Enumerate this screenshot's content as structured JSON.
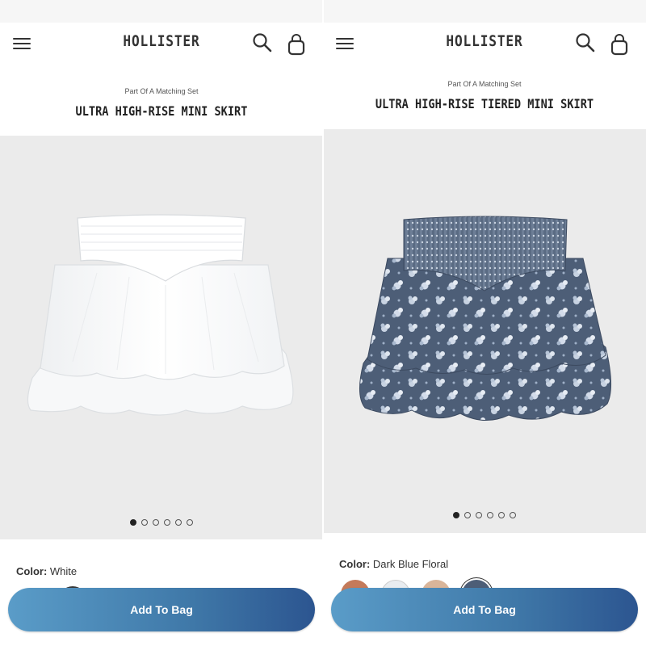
{
  "left": {
    "brand": "HOLLISTER",
    "subtitle": "Part Of A Matching Set",
    "title": "ULTRA HIGH-RISE MINI SKIRT",
    "color_label": "Color:",
    "color_value": "White",
    "add_to_bag": "Add To Bag",
    "carousel_total": 6,
    "carousel_active": 1,
    "skirt_color": "#ffffff"
  },
  "right": {
    "brand": "HOLLISTER",
    "subtitle": "Part Of A Matching Set",
    "title": "ULTRA HIGH-RISE TIERED MINI SKIRT",
    "color_label": "Color:",
    "color_value": "Dark Blue Floral",
    "add_to_bag": "Add To Bag",
    "carousel_total": 6,
    "carousel_active": 1,
    "skirt_color": "#4d5e77"
  },
  "icons": [
    "hamburger-menu-icon",
    "search-icon",
    "shopping-bag-icon"
  ],
  "colors": {
    "button_start": "#5a9cc8",
    "button_end": "#2c5590",
    "image_bg": "#ebebeb"
  }
}
